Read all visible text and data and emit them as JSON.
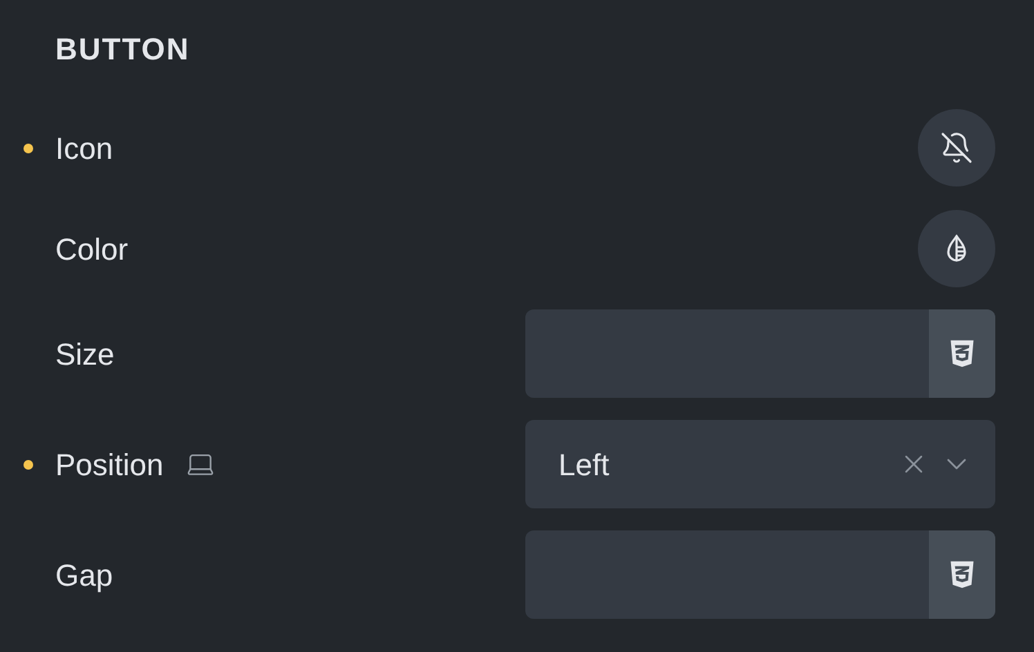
{
  "section": {
    "title": "BUTTON"
  },
  "rows": [
    {
      "kind": "icon",
      "label": "Icon",
      "modified": true,
      "responsive": false
    },
    {
      "kind": "color",
      "label": "Color",
      "modified": false,
      "responsive": false
    },
    {
      "kind": "number",
      "label": "Size",
      "modified": false,
      "responsive": false
    },
    {
      "kind": "select",
      "label": "Position",
      "modified": true,
      "responsive": true,
      "value": "Left"
    },
    {
      "kind": "number",
      "label": "Gap",
      "modified": false,
      "responsive": false
    }
  ]
}
